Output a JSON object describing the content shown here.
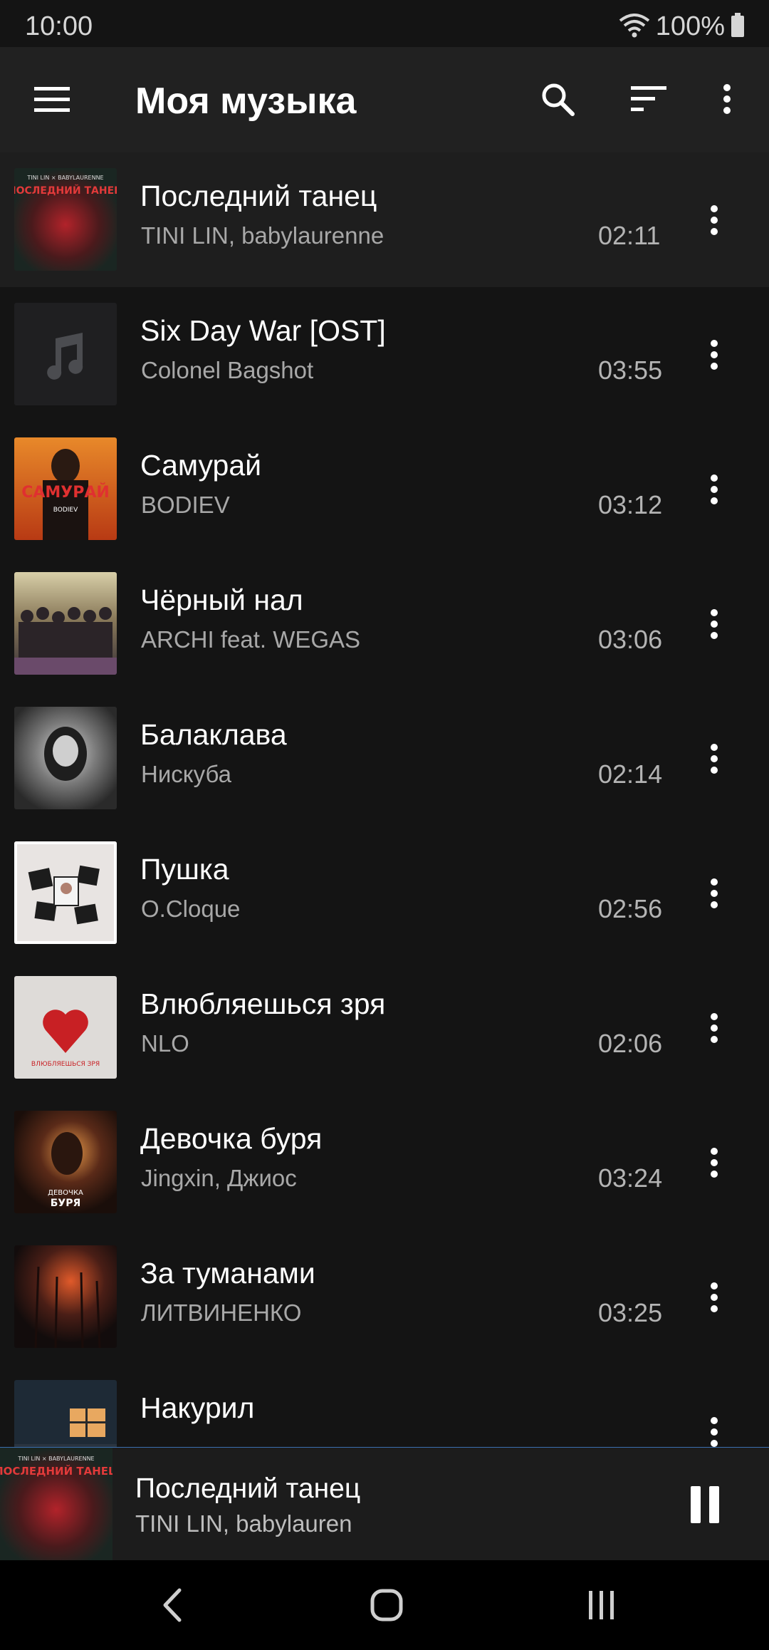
{
  "status_bar": {
    "time": "10:00",
    "battery": "100%",
    "icons": [
      "wifi-icon",
      "battery-icon"
    ]
  },
  "app_bar": {
    "title": "Моя музыка",
    "icons": [
      "menu-icon",
      "search-icon",
      "sort-icon",
      "more-vert-icon"
    ]
  },
  "tracks": [
    {
      "title": "Последний танец",
      "artist": "TINI LIN, babylaurenne",
      "duration": "02:11",
      "cover_label": "ПОСЛЕДНИЙ ТАНЕЦ",
      "cover_sub": "TINI LIN × BABYLAURENNE"
    },
    {
      "title": "Six Day War [OST]",
      "artist": "Colonel Bagshot",
      "duration": "03:55"
    },
    {
      "title": "Самурай",
      "artist": "BODIEV",
      "duration": "03:12",
      "cover_label": "САМУРАЙ",
      "cover_sub": "BODIEV"
    },
    {
      "title": "Чёрный нал",
      "artist": "ARCHI feat. WEGAS",
      "duration": "03:06"
    },
    {
      "title": "Балаклава",
      "artist": "Нискуба",
      "duration": "02:14"
    },
    {
      "title": "Пушка",
      "artist": "O.Cloque",
      "duration": "02:56"
    },
    {
      "title": "Влюбляешься зря",
      "artist": "NLO",
      "duration": "02:06",
      "cover_label": "ВЛЮБЛЯЕШЬСЯ ЗРЯ"
    },
    {
      "title": "Девочка буря",
      "artist": "Jingxin, Джиос",
      "duration": "03:24",
      "cover_label": "ДЕВОЧКА",
      "cover_sub": "БУРЯ"
    },
    {
      "title": "За туманами",
      "artist": "ЛИТВИНЕНКО",
      "duration": "03:25"
    },
    {
      "title": "Накурил",
      "artist": "",
      "duration": ""
    }
  ],
  "player": {
    "title": "Последний танец",
    "artist": "TINI LIN, babylauren",
    "state": "playing"
  },
  "nav_bar": {
    "buttons": [
      "back-icon",
      "home-icon",
      "recents-icon"
    ]
  },
  "colors": {
    "background": "#141414",
    "app_bar": "#212121",
    "player": "#1c1c1c",
    "progress": "#3a6fb0"
  }
}
